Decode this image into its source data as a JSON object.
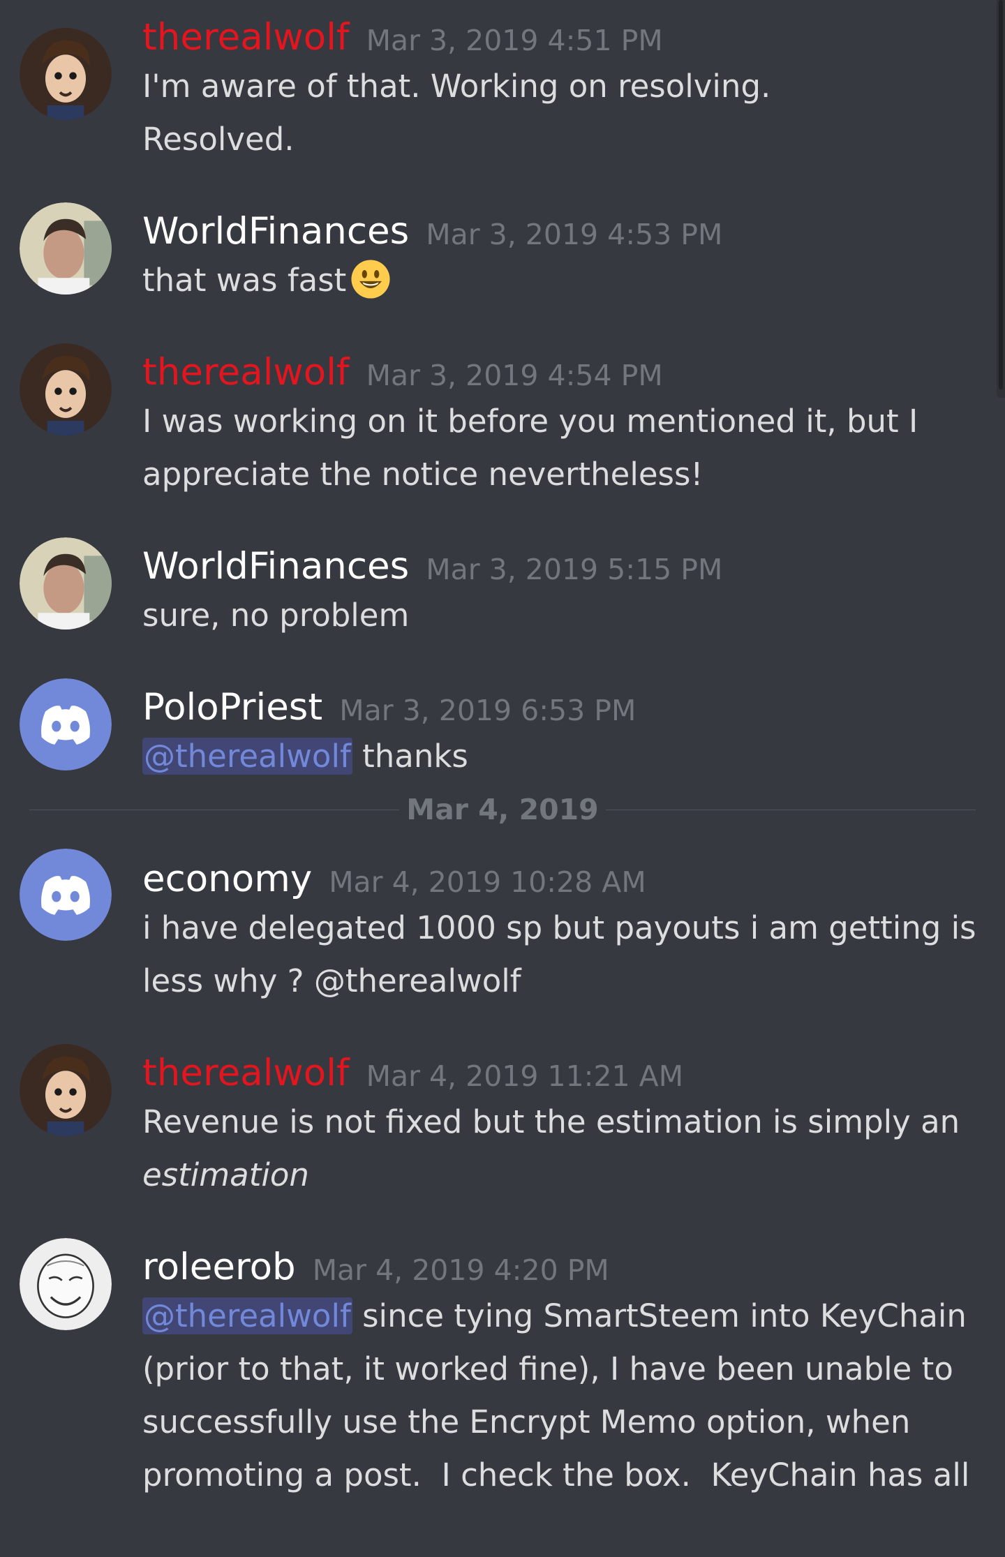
{
  "messages": [
    {
      "user": "therealwolf",
      "time": "Mar 3, 2019 4:51 PM",
      "lines": [
        "I'm aware of that. Working on resolving.",
        "Resolved."
      ]
    },
    {
      "user": "WorldFinances",
      "time": "Mar 3, 2019 4:53 PM",
      "text": "that was fast",
      "emoji": "smiley-emoji"
    },
    {
      "user": "therealwolf",
      "time": "Mar 3, 2019 4:54 PM",
      "lines": [
        "I was working on it before you mentioned it, but I",
        "appreciate the notice nevertheless!"
      ]
    },
    {
      "user": "WorldFinances",
      "time": "Mar 3, 2019 5:15 PM",
      "text": "sure, no problem"
    },
    {
      "user": "PoloPriest",
      "time": "Mar 3, 2019 6:53 PM",
      "mention": "@therealwolf",
      "text": " thanks"
    },
    {
      "user": "economy",
      "time": "Mar 4, 2019 10:28 AM",
      "lines": [
        "i have delegated 1000 sp but payouts i am getting is",
        "less why ? @therealwolf"
      ]
    },
    {
      "user": "therealwolf",
      "time": "Mar 4, 2019 11:21 AM",
      "lines": [
        "Revenue is not fixed but the estimation is simply an",
        "estimation"
      ]
    },
    {
      "user": "roleerob",
      "time": "Mar 4, 2019 4:20 PM",
      "mention": "@therealwolf",
      "first_line": " since tying SmartSteem into KeyChain",
      "lines": [
        "(prior to that, it worked fine), I have been unable to",
        "successfully use the Encrypt Memo option, when",
        "promoting a post.  I check the box.  KeyChain has all"
      ]
    }
  ],
  "date_divider": "Mar 4, 2019",
  "colors": {
    "background": "#36393f",
    "name_red": "#e3151e",
    "timestamp": "#72767d",
    "mention_bg": "#414675",
    "mention_fg": "#7289da",
    "discord_blurple": "#7289da"
  }
}
